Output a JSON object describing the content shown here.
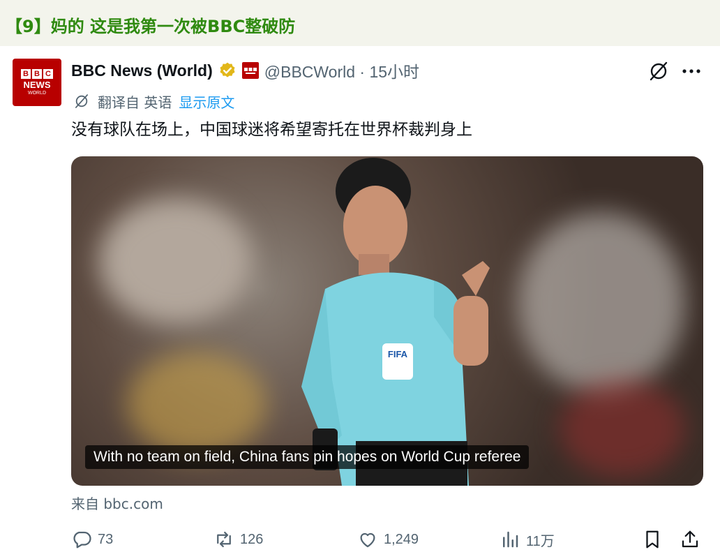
{
  "post": {
    "title": "【9】妈的 这是我第一次被BBC整破防"
  },
  "tweet": {
    "avatar": {
      "bbc": [
        "B",
        "B",
        "C"
      ],
      "news": "NEWS",
      "world": "WORLD"
    },
    "display_name": "BBC News (World)",
    "handle_time": "@BBCWorld · 15小时",
    "translated_from": "翻译自 英语",
    "show_original": "显示原文",
    "text": "没有球队在场上，中国球迷将希望寄托在世界杯裁判身上",
    "media": {
      "caption": "With no team on field, China fans pin hopes on World Cup referee"
    },
    "source": "来自 bbc.com",
    "actions": {
      "replies": "73",
      "retweets": "126",
      "likes": "1,249",
      "views": "11万"
    }
  },
  "icons": {
    "verified": "verified-badge-icon",
    "affiliation": "bbc-affiliation-icon",
    "grok": "grok-icon",
    "more": "more-icon",
    "reply": "reply-icon",
    "retweet": "retweet-icon",
    "like": "like-icon",
    "views": "views-icon",
    "bookmark": "bookmark-icon",
    "share": "share-icon"
  },
  "colors": {
    "title_green": "#2f8a10",
    "bbc_red": "#b80000",
    "link_blue": "#1d9bf0",
    "verified_gold": "#e2b719",
    "muted": "#536471"
  }
}
